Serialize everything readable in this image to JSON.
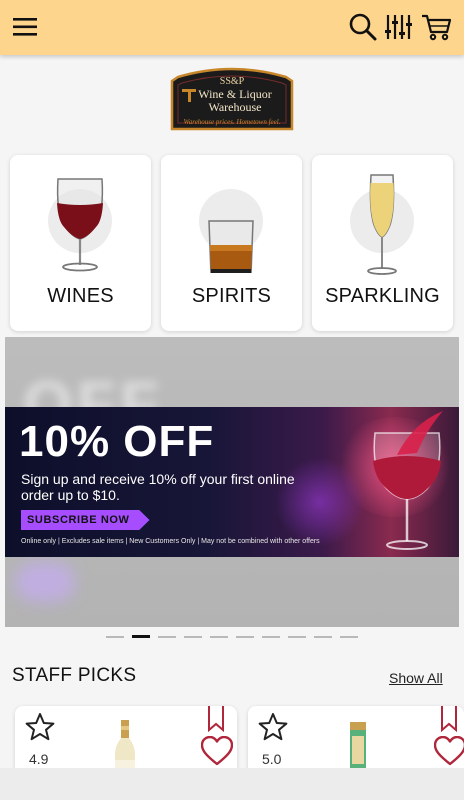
{
  "header": {
    "menu_icon": "hamburger-menu-icon",
    "search_icon": "search-icon",
    "filter_icon": "filter-sliders-icon",
    "cart_icon": "cart-icon",
    "background": "#fdd58c"
  },
  "logo": {
    "line1": "SS&P",
    "line2": "Wine & Liquor",
    "line3": "Warehouse",
    "tagline": "Warehouse prices. Hometown feel."
  },
  "categories": [
    {
      "label": "WINES",
      "icon": "red-wine-glass-icon"
    },
    {
      "label": "SPIRITS",
      "icon": "whiskey-glass-icon"
    },
    {
      "label": "SPARKLING",
      "icon": "champagne-flute-icon"
    }
  ],
  "banner": {
    "headline": "10% OFF",
    "subtext": "Sign up and receive 10% off your first online order up to $10.",
    "cta": "SUBSCRIBE NOW",
    "fine_print": "Online only | Excludes sale items | New Customers Only | May not be combined with other offers",
    "accent": "#a64dff"
  },
  "carousel": {
    "total_slides": 10,
    "active_index": 1
  },
  "staff_picks": {
    "title": "STAFF PICKS",
    "show_all": "Show All",
    "products": [
      {
        "rating": "4.9"
      },
      {
        "rating": "5.0"
      }
    ],
    "accent": "#b0263a"
  }
}
